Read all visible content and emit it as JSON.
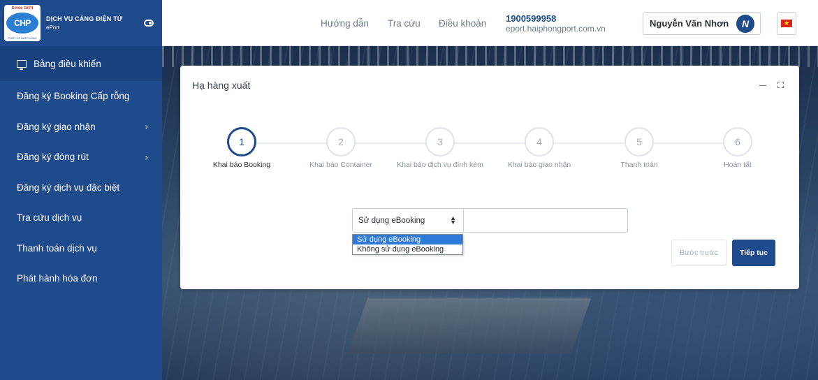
{
  "sidebar": {
    "brand_title": "DỊCH VỤ CẢNG ĐIỆN TỬ",
    "brand_sub": "ePort",
    "logo_text": "CHP",
    "logo_since": "Since 1874",
    "logo_caption": "PORT OF HAI PHONG",
    "items": [
      {
        "label": "Bảng điều khiển",
        "icon": "monitor-icon"
      },
      {
        "label": "Đăng ký Booking Cấp rỗng"
      },
      {
        "label": "Đăng ký giao nhận",
        "has_submenu": true
      },
      {
        "label": "Đăng ký đóng rút",
        "has_submenu": true
      },
      {
        "label": "Đăng ký dịch vụ đặc biệt"
      },
      {
        "label": "Tra cứu dịch vụ"
      },
      {
        "label": "Thanh toán dịch vụ"
      },
      {
        "label": "Phát hành hóa đơn"
      }
    ],
    "chevron": "›"
  },
  "header": {
    "nav": [
      "Hướng dẫn",
      "Tra cứu",
      "Điều khoản"
    ],
    "hotline": "1900599958",
    "website": "eport.haiphongport.com.vn",
    "user_name": "Nguyễn Văn Nhơn",
    "avatar_initial": "N",
    "flag_star": "★"
  },
  "card": {
    "title": "Hạ hàng xuất",
    "steps": [
      {
        "num": "1",
        "label": "Khai báo Booking",
        "active": true
      },
      {
        "num": "2",
        "label": "Khai báo Container"
      },
      {
        "num": "3",
        "label": "Khai báo dịch vụ đính kèm"
      },
      {
        "num": "4",
        "label": "Khai báo giao nhận"
      },
      {
        "num": "5",
        "label": "Thanh toán"
      },
      {
        "num": "6",
        "label": "Hoàn tất"
      }
    ],
    "select_value": "Sử dụng eBooking",
    "options": [
      "Sử dụng eBooking",
      "Không sử dụng eBooking"
    ],
    "btn_prev": "Bước trước",
    "btn_next": "Tiếp tục"
  },
  "colors": {
    "primary": "#1f4a8c",
    "selected_option": "#2e7ad9",
    "flag_red": "#da251d"
  }
}
